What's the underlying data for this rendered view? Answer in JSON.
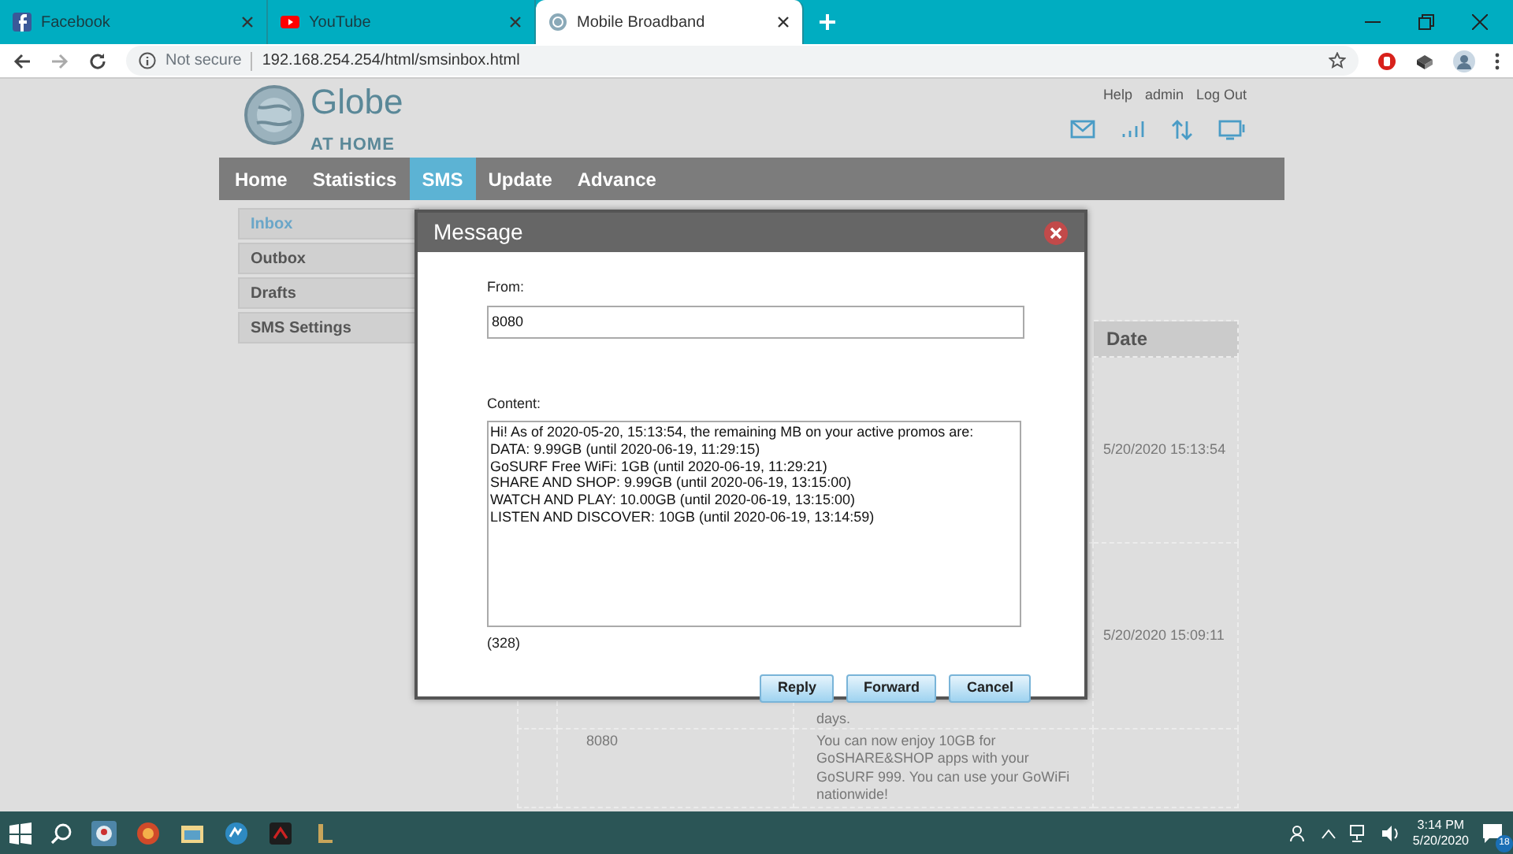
{
  "browser": {
    "tabs": [
      {
        "title": "Facebook",
        "selected": false
      },
      {
        "title": "YouTube",
        "selected": false
      },
      {
        "title": "Mobile Broadband",
        "selected": true
      }
    ],
    "address": {
      "security": "Not secure",
      "url": "192.168.254.254/html/smsinbox.html"
    }
  },
  "header": {
    "logo_text": "Globe",
    "logo_subtext": "AT HOME",
    "links": [
      "Help",
      "admin",
      "Log Out"
    ]
  },
  "nav": [
    {
      "label": "Home",
      "selected": false
    },
    {
      "label": "Statistics",
      "selected": false
    },
    {
      "label": "SMS",
      "selected": true
    },
    {
      "label": "Update",
      "selected": false
    },
    {
      "label": "Advance",
      "selected": false
    }
  ],
  "sidebar": [
    {
      "label": "Inbox",
      "selected": true
    },
    {
      "label": "Outbox",
      "selected": false
    },
    {
      "label": "Drafts",
      "selected": false
    },
    {
      "label": "SMS Settings",
      "selected": false
    }
  ],
  "table": {
    "columns": [
      "Date"
    ],
    "rows": [
      {
        "date": "5/20/2020 15:13:54"
      },
      {
        "message": "days.",
        "date": "5/20/2020 15:09:11"
      },
      {
        "sender": "8080",
        "message": "You can now enjoy 10GB for GoSHARE&SHOP apps with your GoSURF 999. You can use your GoWiFi nationwide!"
      }
    ]
  },
  "dialog": {
    "title": "Message",
    "from_label": "From:",
    "from_value": "8080",
    "content_label": "Content:",
    "content_value": "Hi! As of 2020-05-20, 15:13:54, the remaining MB on your active promos are:\nDATA: 9.99GB (until 2020-06-19, 11:29:15)\nGoSURF Free WiFi: 1GB (until 2020-06-19, 11:29:21)\nSHARE AND SHOP: 9.99GB (until 2020-06-19, 13:15:00)\nWATCH AND PLAY: 10.00GB (until 2020-06-19, 13:15:00)\nLISTEN AND DISCOVER: 10GB (until 2020-06-19, 13:14:59)",
    "char_count": "(328)",
    "buttons": [
      "Reply",
      "Forward",
      "Cancel"
    ]
  },
  "taskbar": {
    "time": "3:14 PM",
    "date": "5/20/2020",
    "notifications": "18"
  }
}
